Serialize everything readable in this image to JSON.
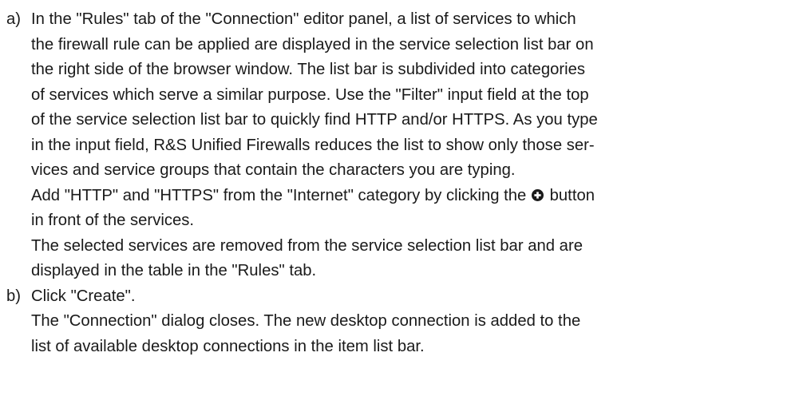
{
  "steps": [
    {
      "marker": "a)",
      "lines": [
        "In the \"Rules\" tab of the \"Connection\" editor panel, a list of services to which",
        "the firewall rule can be applied are displayed in the service selection list bar on",
        "the right side of the browser window. The list bar is subdivided into categories",
        "of services which serve a similar purpose. Use the \"Filter\" input field at the top",
        "of the service selection list bar to quickly find HTTP and/or HTTPS. As you type",
        "in the input field, R&S Unified Firewalls reduces the list to show only those ser-",
        "vices and service groups that contain the characters you are typing."
      ],
      "add_line_before_icon": "Add \"HTTP\" and \"HTTPS\" from the \"Internet\" category by clicking the",
      "add_line_after_icon": "button",
      "add_line_cont": "in front of the services.",
      "result_lines": [
        "The selected services are removed from the service selection list bar and are",
        "displayed in the table in the \"Rules\" tab."
      ]
    },
    {
      "marker": "b)",
      "lines": [
        "Click \"Create\"."
      ],
      "result_lines": [
        "The \"Connection\" dialog closes. The new desktop connection is added to the",
        "list of available desktop connections in the item list bar."
      ]
    }
  ],
  "icons": {
    "add_button_icon": "plus-circle-icon"
  }
}
